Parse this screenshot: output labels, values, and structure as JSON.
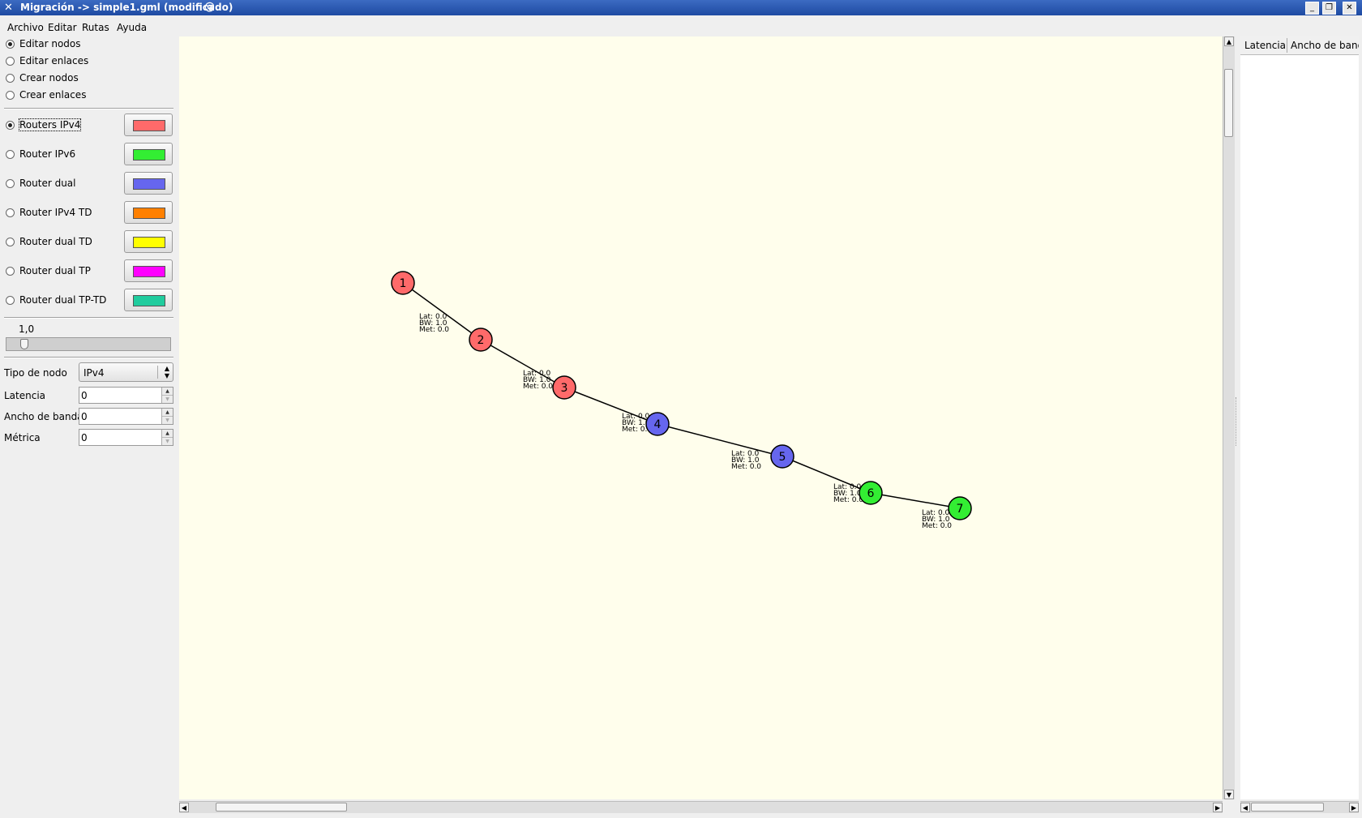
{
  "window": {
    "title": "Migración -> simple1.gml (modificado)",
    "minimize": "_",
    "maximize": "❐",
    "close": "✕"
  },
  "menu": [
    "Archivo",
    "Editar",
    "Rutas",
    "Ayuda"
  ],
  "modes": [
    {
      "label": "Editar nodos",
      "selected": true
    },
    {
      "label": "Editar enlaces",
      "selected": false
    },
    {
      "label": "Crear nodos",
      "selected": false
    },
    {
      "label": "Crear enlaces",
      "selected": false
    }
  ],
  "router_types": [
    {
      "label": "Routers IPv4",
      "selected": true,
      "color": "#ff6a6a"
    },
    {
      "label": "Router IPv6",
      "selected": false,
      "color": "#33ee33"
    },
    {
      "label": "Router dual",
      "selected": false,
      "color": "#6666ee"
    },
    {
      "label": "Router IPv4 TD",
      "selected": false,
      "color": "#ff8000"
    },
    {
      "label": "Router dual TD",
      "selected": false,
      "color": "#ffff00"
    },
    {
      "label": "Router dual TP",
      "selected": false,
      "color": "#ff00ff"
    },
    {
      "label": "Router dual TP-TD",
      "selected": false,
      "color": "#20cc9e"
    }
  ],
  "zoom": {
    "value_label": "1,0",
    "value": 1.0
  },
  "form": {
    "node_type_label": "Tipo de nodo",
    "node_type_value": "IPv4",
    "latency_label": "Latencia",
    "latency_value": "0",
    "bandwidth_label": "Ancho de banda",
    "bandwidth_value": "0",
    "metric_label": "Métrica",
    "metric_value": "0"
  },
  "table_headers": [
    "Latencia",
    "Ancho de band"
  ],
  "graph": {
    "nodes": [
      {
        "id": "1",
        "type": "ipv4"
      },
      {
        "id": "2",
        "type": "ipv4"
      },
      {
        "id": "3",
        "type": "ipv4"
      },
      {
        "id": "4",
        "type": "dual"
      },
      {
        "id": "5",
        "type": "dual"
      },
      {
        "id": "6",
        "type": "ipv6"
      },
      {
        "id": "7",
        "type": "ipv6"
      }
    ],
    "node_colors": {
      "ipv4": "#ff6a6a",
      "dual": "#6666ee",
      "ipv6": "#33ee33"
    },
    "edges": [
      {
        "from": "1",
        "to": "2",
        "lat": "Lat: 0.0",
        "bw": "BW: 1.0",
        "met": "Met: 0.0"
      },
      {
        "from": "2",
        "to": "3",
        "lat": "Lat: 0.0",
        "bw": "BW: 1.0",
        "met": "Met: 0.0"
      },
      {
        "from": "3",
        "to": "4",
        "lat": "Lat: 0.0",
        "bw": "BW: 1.0",
        "met": "Met: 0.0"
      },
      {
        "from": "4",
        "to": "5",
        "lat": "Lat: 0.0",
        "bw": "BW: 1.0",
        "met": "Met: 0.0"
      },
      {
        "from": "5",
        "to": "6",
        "lat": "Lat: 0.0",
        "bw": "BW: 1.0",
        "met": "Met: 0.0"
      },
      {
        "from": "6",
        "to": "7",
        "lat": "Lat: 0.0",
        "bw": "BW: 1.0",
        "met": "Met: 0.0"
      }
    ]
  }
}
